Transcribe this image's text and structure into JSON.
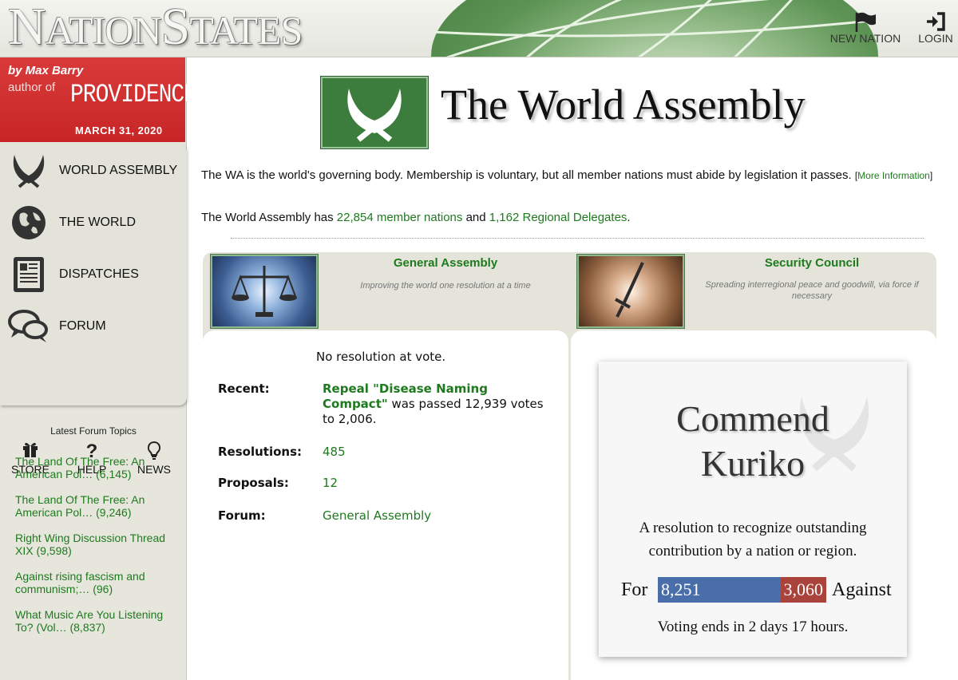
{
  "header": {
    "logo": {
      "n": "N",
      "ation": "ATION",
      "s": "S",
      "tates": "TATES"
    },
    "new_nation": "NEW NATION",
    "login": "LOGIN"
  },
  "banner": {
    "by": "by Max Barry",
    "author_of": "author of",
    "book": "PROVIDENCE",
    "date": "MARCH 31, 2020"
  },
  "sidebar": {
    "nav": [
      {
        "label": "WORLD ASSEMBLY",
        "icon": "world-assembly-icon"
      },
      {
        "label": "THE WORLD",
        "icon": "globe-icon"
      },
      {
        "label": "DISPATCHES",
        "icon": "newspaper-icon"
      },
      {
        "label": "FORUM",
        "icon": "speech-bubbles-icon"
      }
    ],
    "subnav": [
      {
        "label": "STORE",
        "icon": "gift-icon"
      },
      {
        "label": "HELP",
        "icon": "question-icon"
      },
      {
        "label": "NEWS",
        "icon": "lightbulb-icon"
      }
    ],
    "topics_title": "Latest Forum Topics",
    "topics": [
      {
        "line1": "The Land Of The Free: An",
        "line2": "American Pol… (6,145)"
      },
      {
        "line1": "The Land Of The Free: An",
        "line2": "American Pol… (9,246)"
      },
      {
        "line1": "Right Wing Discussion Thread",
        "line2": "XIX (9,598)"
      },
      {
        "line1": "Against rising fascism and",
        "line2": "communism;… (96)"
      },
      {
        "line1": "What Music Are You Listening",
        "line2": "To? (Vol… (8,837)"
      }
    ]
  },
  "main": {
    "title": "The World Assembly",
    "intro": "The WA is the world's governing body. Membership is voluntary, but all member nations must abide by legislation it passes.",
    "more_open": "[",
    "more_link": "More Information",
    "more_close": "]",
    "stats_prefix": "The World Assembly has",
    "members_link": "22,854 member nations",
    "stats_and": "and",
    "delegates_link": "1,162 Regional Delegates",
    "stats_end": "."
  },
  "ga": {
    "name": "General Assembly",
    "subtitle": "Improving the world one resolution at a time",
    "status": "No resolution at vote.",
    "recent_label": "Recent:",
    "recent_link": "Repeal \"Disease Naming Compact\"",
    "recent_text": "was passed 12,939 votes to 2,006.",
    "resolutions_label": "Resolutions:",
    "resolutions": "485",
    "proposals_label": "Proposals:",
    "proposals": "12",
    "forum_label": "Forum:",
    "forum": "General Assembly"
  },
  "sc": {
    "name": "Security Council",
    "subtitle": "Spreading interregional peace and goodwill, via force if necessary",
    "resolution_line1": "Commend",
    "resolution_line2": "Kuriko",
    "description": "A resolution to recognize outstanding contribution by a nation or region.",
    "for_label": "For",
    "for_votes": "8,251",
    "against_votes": "3,060",
    "against_label": "Against",
    "for_fraction": 0.7295,
    "for_color": "#4a6ea9",
    "against_color": "#a9433b",
    "voting_ends": "Voting ends in 2 days 17 hours."
  }
}
